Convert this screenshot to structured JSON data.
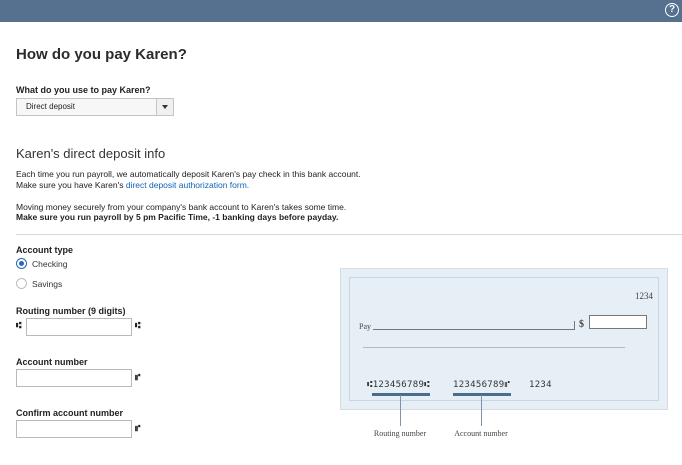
{
  "header": {
    "help_icon": "question-circle-icon",
    "help_glyph": "?"
  },
  "page_title": "How do you pay Karen?",
  "payment_method": {
    "label": "What do you use to pay Karen?",
    "selected": "Direct deposit"
  },
  "direct_deposit": {
    "title": "Karen's direct deposit info",
    "p1_line1": "Each time you run payroll, we automatically deposit Karen's pay check in this bank account.",
    "p1_line2_prefix": "Make sure you have Karen's",
    "p1_link": "direct deposit authorization form.",
    "p2_line1": "Moving money securely from your company's bank account to Karen's takes some time.",
    "p2_line2": "Make sure you run payroll by 5 pm Pacific Time, -1 banking days before payday."
  },
  "account_type": {
    "label": "Account type",
    "options": [
      {
        "label": "Checking",
        "selected": true
      },
      {
        "label": "Savings",
        "selected": false
      }
    ]
  },
  "routing_number": {
    "label": "Routing number (9 digits)",
    "value": "",
    "symbol": "⑆"
  },
  "account_number": {
    "label": "Account number",
    "value": "",
    "symbol": "⑈"
  },
  "confirm_account_number": {
    "label": "Confirm account number",
    "value": "",
    "symbol": "⑈"
  },
  "check_image": {
    "check_number": "1234",
    "pay_label": "Pay",
    "dollar_sign": "$",
    "micr_routing": "⑆123456789⑆",
    "micr_account": "123456789⑈",
    "micr_check": "1234",
    "routing_caption": "Routing number",
    "account_caption": "Account number",
    "colors": {
      "background": "#e7eff6",
      "marker": "#4c6c8c"
    }
  }
}
